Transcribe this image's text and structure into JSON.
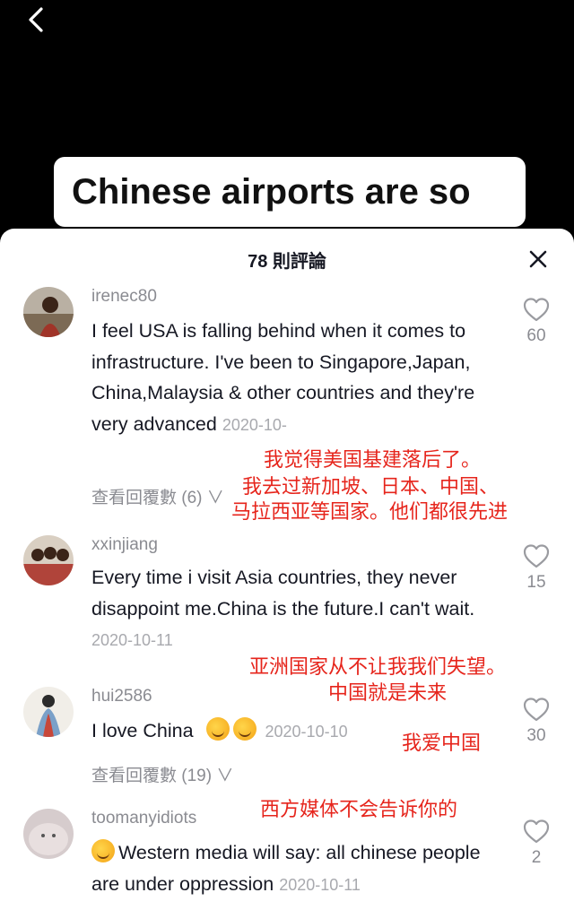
{
  "video": {
    "caption": "Chinese airports are so"
  },
  "sheet": {
    "title": "78 則評論"
  },
  "comments": [
    {
      "username": "irenec80",
      "text": "I feel USA is falling behind when it comes to infrastructure. I've been to Singapore,Japan, China,Malaysia & other countries and they're very advanced",
      "timestamp": "2020-10-",
      "replies": "查看回覆數 (6) ∨",
      "likes": "60",
      "avatar_color": "#a04030"
    },
    {
      "username": "xxinjiang",
      "text": "Every time i visit Asia countries, they never disappoint me.China is the future.I can't wait.",
      "timestamp": "2020-10-11",
      "likes": "15",
      "avatar_color": "#b0443a"
    },
    {
      "username": "hui2586",
      "text": "I love China",
      "timestamp": "2020-10-10",
      "replies": "查看回覆數 (19) ∨",
      "likes": "30",
      "avatar_color": "#e8e4dc"
    },
    {
      "username": "toomanyidiots",
      "text": "Western media will say: all chinese people are under oppression",
      "timestamp": "2020-10-11",
      "likes": "2",
      "avatar_color": "#cfc6c8"
    }
  ],
  "annotations": {
    "c1_line1": "我觉得美国基建落后了。",
    "c1_line2": "我去过新加坡、日本、中国、",
    "c1_line3": "马拉西亚等国家。他们都很先进",
    "c2_line1": "亚洲国家从不让我我们失望。",
    "c2_line2": "中国就是未来",
    "c3_line1": "我爱中国",
    "c4_line1": "西方媒体不会告诉你的"
  },
  "colors": {
    "annotation_red": "#e6251c",
    "secondary_gray": "#8a8b91"
  },
  "icons": [
    "back-icon",
    "close-icon",
    "heart-icon",
    "smiling-face-with-hearts-emoji"
  ]
}
